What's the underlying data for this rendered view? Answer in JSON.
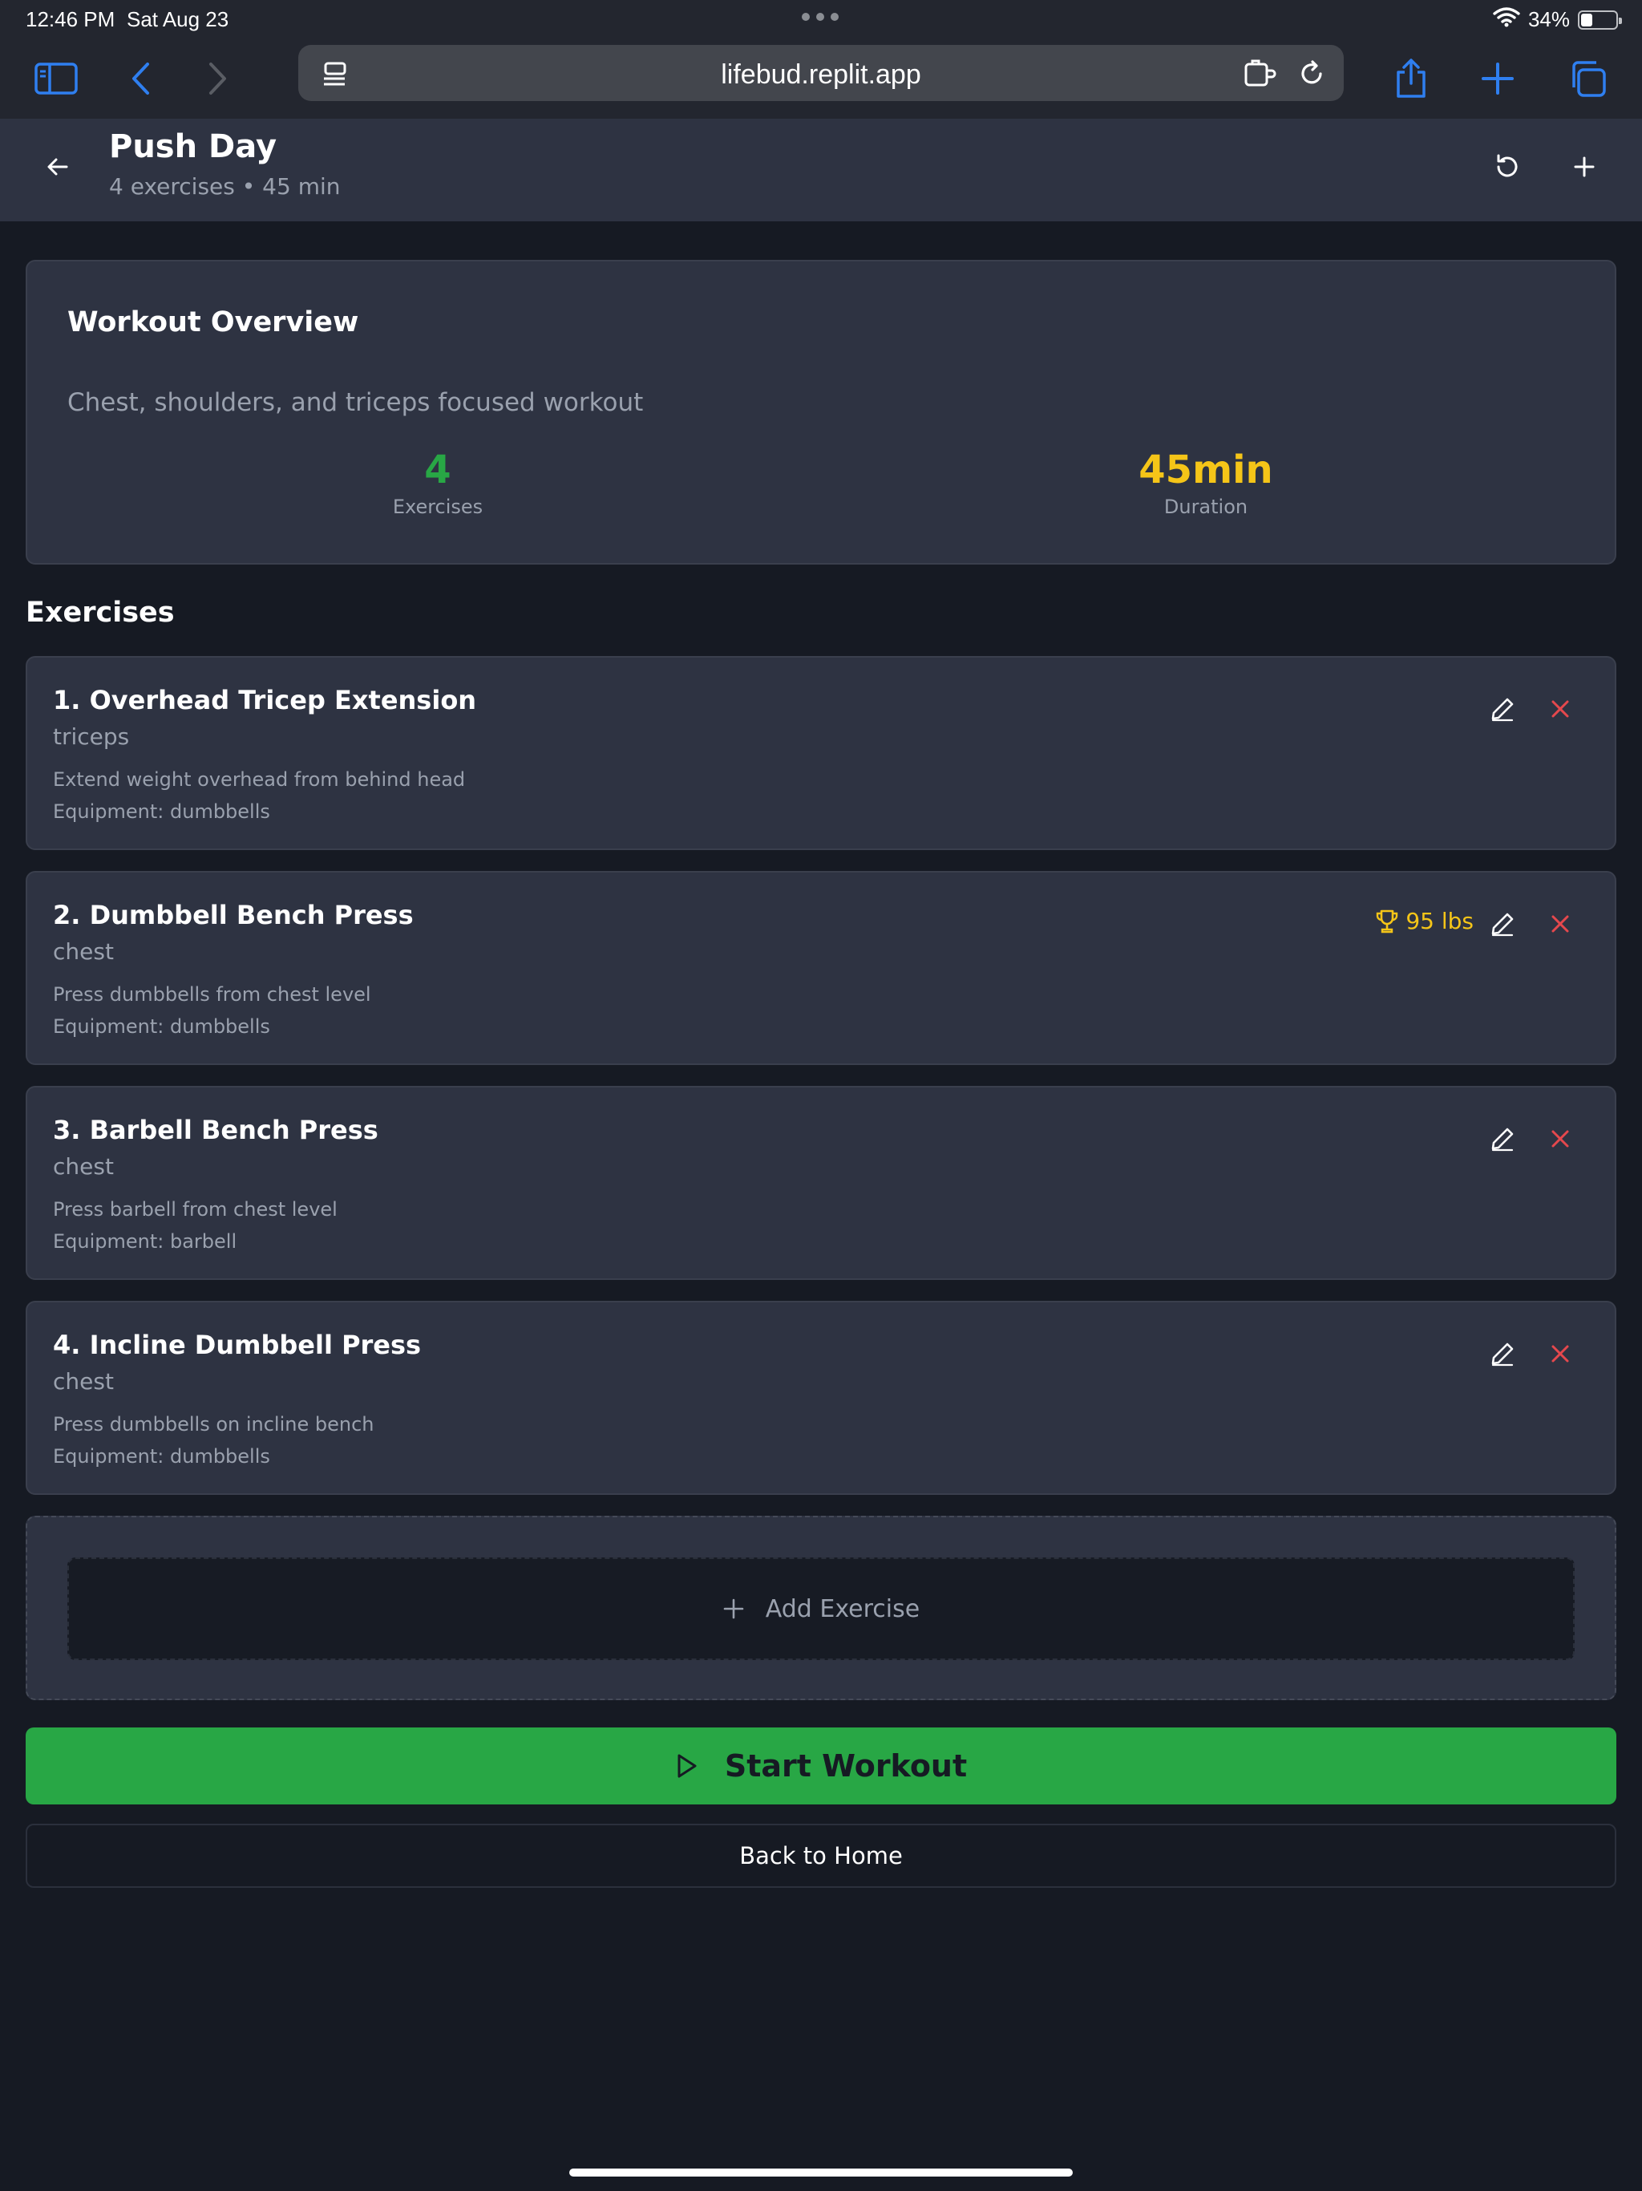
{
  "status": {
    "time": "12:46 PM",
    "date": "Sat Aug 23",
    "battery": "34%",
    "battery_level": 0.34
  },
  "browser": {
    "url": "lifebud.replit.app",
    "icons": [
      "sidebar-icon",
      "back-arrow-icon",
      "forward-arrow-icon",
      "reader-icon",
      "extension-icon",
      "reload-icon",
      "share-icon",
      "new-tab-icon",
      "tabs-icon"
    ]
  },
  "header": {
    "title": "Push Day",
    "subtitle": "4 exercises • 45 min"
  },
  "overview": {
    "title": "Workout Overview",
    "description": "Chest, shoulders, and triceps focused workout",
    "stats": [
      {
        "value": "4",
        "label": "Exercises",
        "color": "#28a745"
      },
      {
        "value": "45min",
        "label": "Duration",
        "color": "#f5c518"
      }
    ]
  },
  "exercises_title": "Exercises",
  "exercises": [
    {
      "name": "1. Overhead Tricep Extension",
      "muscle": "triceps",
      "description": "Extend weight overhead from behind head",
      "equipment": "Equipment: dumbbells",
      "pr": ""
    },
    {
      "name": "2. Dumbbell Bench Press",
      "muscle": "chest",
      "description": "Press dumbbells from chest level",
      "equipment": "Equipment: dumbbells",
      "pr": "95 lbs"
    },
    {
      "name": "3. Barbell Bench Press",
      "muscle": "chest",
      "description": "Press barbell from chest level",
      "equipment": "Equipment: barbell",
      "pr": ""
    },
    {
      "name": "4. Incline Dumbbell Press",
      "muscle": "chest",
      "description": "Press dumbbells on incline bench",
      "equipment": "Equipment: dumbbells",
      "pr": ""
    }
  ],
  "add_exercise_label": "Add Exercise",
  "start_label": "Start Workout",
  "home_label": "Back to Home",
  "colors": {
    "accent_green": "#28a745",
    "accent_yellow": "#f5c518",
    "danger": "#e5484d",
    "safari_blue": "#2f7ff0"
  }
}
